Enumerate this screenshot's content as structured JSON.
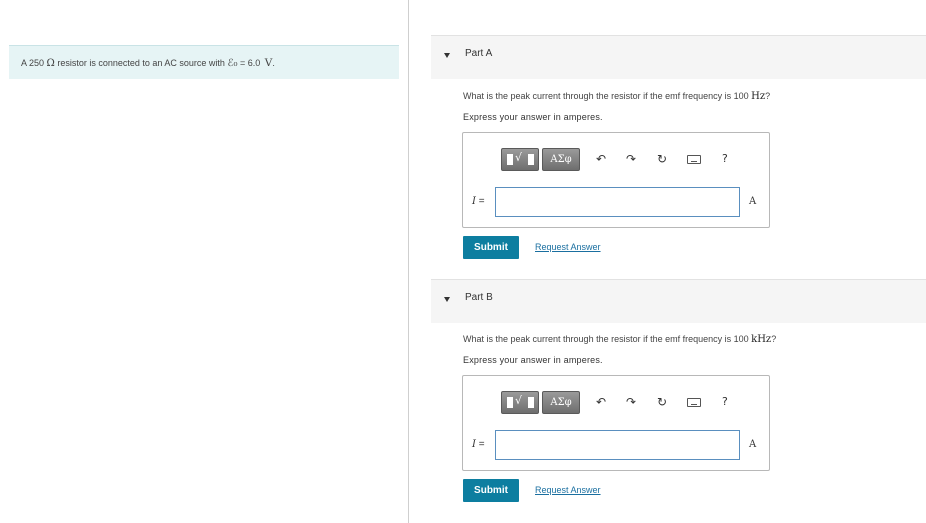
{
  "problem": {
    "prefix": "A 250",
    "ohm": "Ω",
    "mid": " resistor is connected to an AC source with ",
    "emf_symbol": "ℰ₀",
    "equals": " = 6.0 ",
    "unit": "V",
    "end": "."
  },
  "parts": [
    {
      "title": "Part A",
      "question": "What is the peak current through the resistor if the emf frequency is 100 ",
      "question_unit": "Hz",
      "question_end": "?",
      "express": "Express your answer in amperes.",
      "var": "I",
      "eq": " =",
      "input_value": "",
      "unit": "A",
      "submit": "Submit",
      "request": "Request Answer",
      "greek": "ΑΣφ",
      "help": "?"
    },
    {
      "title": "Part B",
      "question": "What is the peak current through the resistor if the emf frequency is 100 ",
      "question_unit": "kHz",
      "question_end": "?",
      "express": "Express your answer in amperes.",
      "var": "I",
      "eq": " =",
      "input_value": "",
      "unit": "A",
      "submit": "Submit",
      "request": "Request Answer",
      "greek": "ΑΣφ",
      "help": "?"
    }
  ],
  "icons": {
    "undo": "↶",
    "redo": "↷",
    "reset": "↻"
  },
  "colors": {
    "problem_bg": "#e6f4f5",
    "submit_bg": "#0d7ea0",
    "link": "#1a6fa0",
    "input_border": "#5a8fbf"
  }
}
